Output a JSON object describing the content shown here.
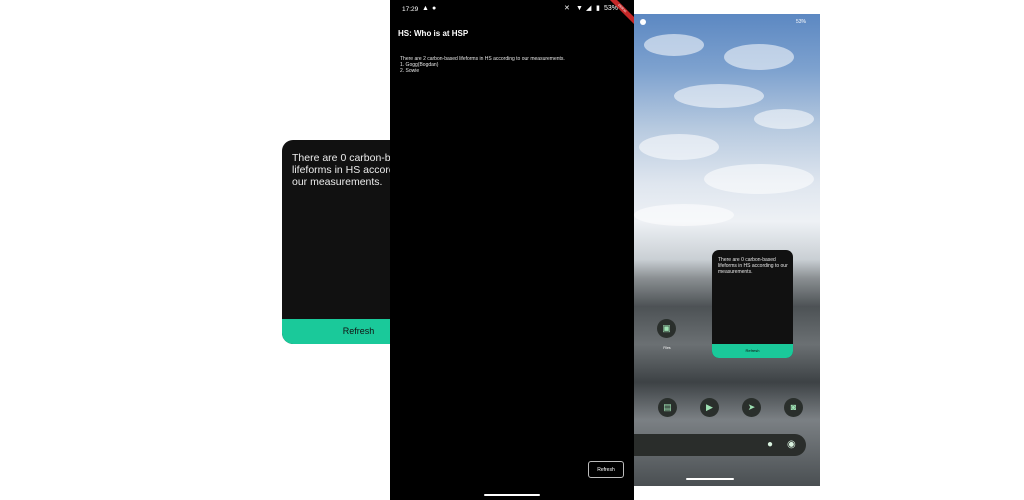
{
  "big_widget": {
    "message": "There are 0 carbon-based lifeforms in HS according to our measurements.",
    "button_label": "Refresh",
    "accent_color": "#1ac99a"
  },
  "phone": {
    "status_time": "17:29",
    "battery": "53%",
    "app_title": "HS: Who is at HSP",
    "summary": "There are 2 carbon-based lifeforms in HS according to our measurements.",
    "members": [
      "1. Gogg(Bogdan)",
      "2. Sowie"
    ],
    "refresh_label": "Refresh",
    "debug_banner": "DEBUG"
  },
  "home": {
    "battery": "53%",
    "widget_message": "There are 0 carbon-based lifeforms in HS according to our measurements.",
    "widget_button_label": "Refresh",
    "apps": [
      {
        "icon": "gallery-icon",
        "label": "Files"
      },
      {
        "icon": "messages-icon",
        "label": ""
      },
      {
        "icon": "play-store-icon",
        "label": ""
      },
      {
        "icon": "telegram-icon",
        "label": ""
      },
      {
        "icon": "camera-icon",
        "label": ""
      }
    ]
  }
}
